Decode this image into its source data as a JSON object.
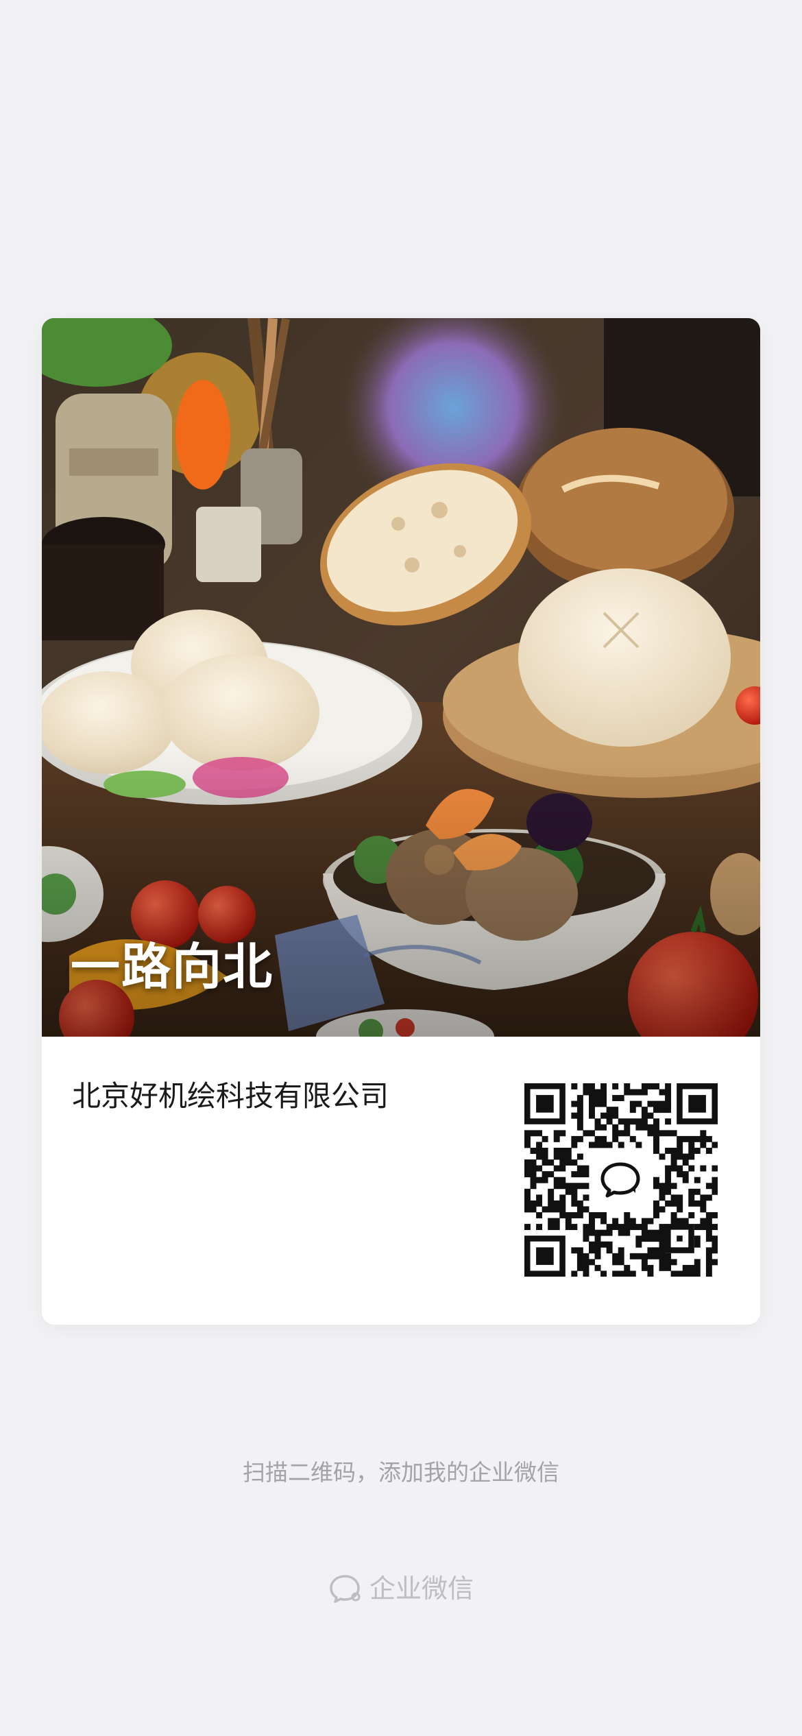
{
  "card": {
    "cover_title": "一路向北",
    "company_name": "北京好机绘科技有限公司",
    "qr_icon": "wecom-chat-icon"
  },
  "footer": {
    "hint": "扫描二维码，添加我的企业微信",
    "brand_label": "企业微信",
    "brand_icon": "wecom-logo-icon"
  }
}
